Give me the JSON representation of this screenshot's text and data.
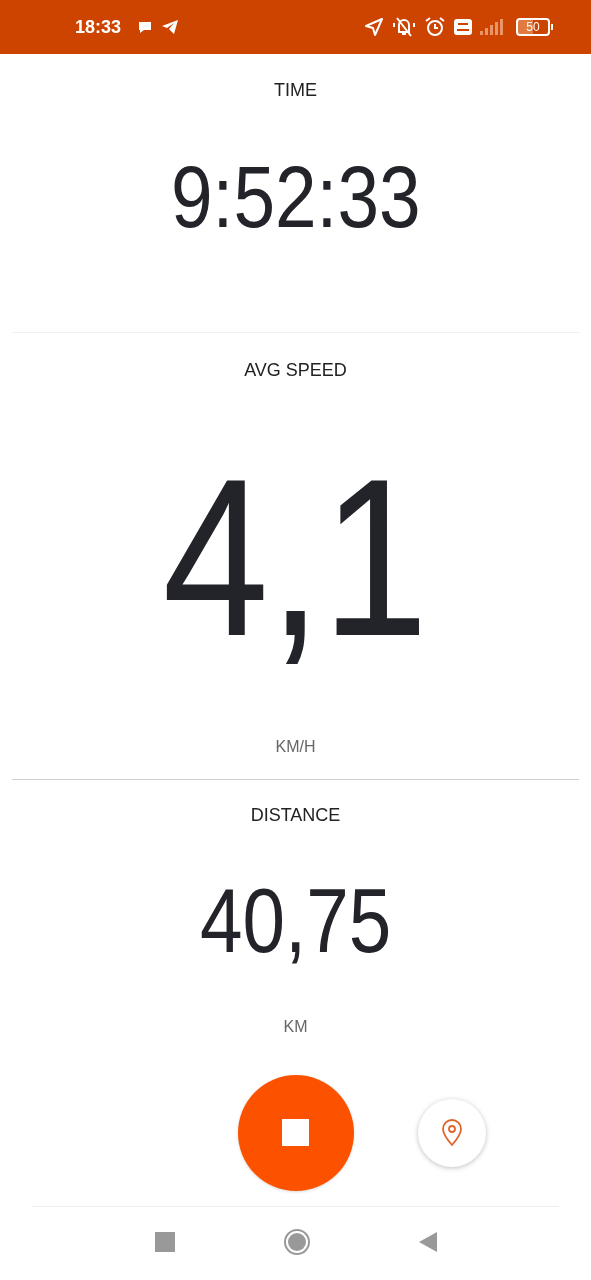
{
  "status_bar": {
    "time": "18:33",
    "battery": "50"
  },
  "metrics": [
    {
      "label": "TIME",
      "value": "9:52:33"
    },
    {
      "label": "AVG SPEED",
      "value": "4,1",
      "unit": "KM/H"
    },
    {
      "label": "DISTANCE",
      "value": "40,75",
      "unit": "KM"
    }
  ]
}
